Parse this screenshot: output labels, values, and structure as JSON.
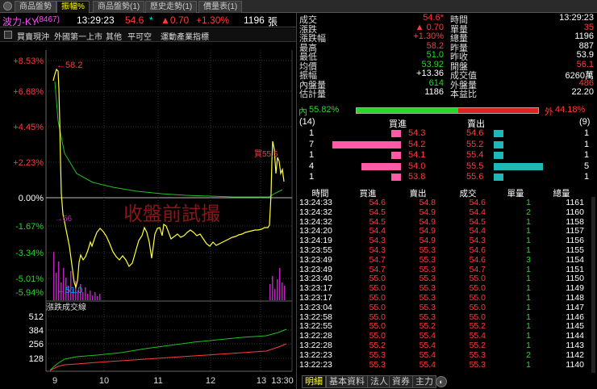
{
  "tabs": [
    "商品盤勢",
    "振幅%",
    "商品盤勢(1)",
    "歷史走勢(1)",
    "價量表(1)"
  ],
  "header": {
    "name": "波力-KY",
    "code": "(8467)",
    "time": "13:29:23",
    "price": "54.6",
    "star": "*",
    "change": "▲0.70",
    "change_pct": "+1.30%",
    "volume": "1196",
    "vol_unit": "張"
  },
  "menu": {
    "items": [
      "買賣現沖",
      "外國第一上市",
      "其他",
      "平可空",
      "運動產業指標"
    ]
  },
  "chart": {
    "y_labels": [
      "+8.53%",
      "+6.68%",
      "+4.45%",
      "+2.23%",
      "0.00%",
      "-1.67%",
      "-3.34%",
      "-5.01%",
      "-5.94%"
    ],
    "x_labels": [
      "9",
      "10",
      "11",
      "12",
      "13",
      "13:30"
    ],
    "high_label": "58.2",
    "low_label": "51.0",
    "mid_label": "56",
    "buy_mark": "買55.6",
    "watermark": "收盤前試撮",
    "vol_title": "漲跌成交線",
    "vol_ticks": [
      "512",
      "384",
      "256",
      "128"
    ],
    "colors": {
      "price": "#ffff3c",
      "avg": "#22c022",
      "vol": "#c020c0"
    }
  },
  "quote": {
    "left": [
      {
        "label": "成交",
        "value": "54.6*",
        "cls": "red"
      },
      {
        "label": "漲跌",
        "value": "▲ 0.70",
        "cls": "red"
      },
      {
        "label": "漲跌幅",
        "value": "+1.30%",
        "cls": "red"
      },
      {
        "label": "最高",
        "value": "58.2",
        "cls": "red"
      },
      {
        "label": "最低",
        "value": "51.0",
        "cls": "green"
      },
      {
        "label": "均價",
        "value": "53.92",
        "cls": "green"
      },
      {
        "label": "振幅",
        "value": "+13.36",
        "cls": "white"
      },
      {
        "label": "內盤量",
        "value": "614",
        "cls": "green"
      },
      {
        "label": "估計量",
        "value": "1186",
        "cls": "white"
      }
    ],
    "right": [
      {
        "label": "時間",
        "value": "13:29:23",
        "cls": "white"
      },
      {
        "label": "單量",
        "value": "35",
        "cls": "red"
      },
      {
        "label": "總量",
        "value": "1196",
        "cls": "white"
      },
      {
        "label": "昨量",
        "value": "887",
        "cls": "white"
      },
      {
        "label": "昨收",
        "value": "53.9",
        "cls": "white"
      },
      {
        "label": "開盤",
        "value": "56.1",
        "cls": "red"
      },
      {
        "label": "成交值",
        "value": "6260萬",
        "cls": "white"
      },
      {
        "label": "外盤量",
        "value": "486",
        "cls": "red"
      },
      {
        "label": "本益比",
        "value": "22.20",
        "cls": "white"
      }
    ]
  },
  "ratio": {
    "inner_label": "內",
    "inner_pct": "55.82%",
    "outer_label": "外",
    "outer_pct": "44.18%",
    "inner_fraction": 0.5582
  },
  "book": {
    "bid_count": "(14)",
    "ask_count": "(9)",
    "bid_header": "買進",
    "ask_header": "賣出",
    "rows": [
      {
        "bid_vol": "1",
        "bid": "54.3",
        "ask": "54.6",
        "ask_vol": "1",
        "bid_n": 1,
        "ask_n": 1
      },
      {
        "bid_vol": "7",
        "bid": "54.2",
        "ask": "55.2",
        "ask_vol": "1",
        "bid_n": 7,
        "ask_n": 1
      },
      {
        "bid_vol": "1",
        "bid": "54.1",
        "ask": "55.4",
        "ask_vol": "1",
        "bid_n": 1,
        "ask_n": 1
      },
      {
        "bid_vol": "4",
        "bid": "54.0",
        "ask": "55.5",
        "ask_vol": "5",
        "bid_n": 4,
        "ask_n": 5
      },
      {
        "bid_vol": "1",
        "bid": "53.8",
        "ask": "55.6",
        "ask_vol": "1",
        "bid_n": 1,
        "ask_n": 1
      }
    ]
  },
  "ticks": {
    "headers": [
      "時間",
      "買進",
      "賣出",
      "成交",
      "單量",
      "總量"
    ],
    "rows": [
      [
        "13:24:33",
        "54.6",
        "54.8",
        "54.6",
        "1",
        "1161"
      ],
      [
        "13:24:32",
        "54.5",
        "54.9",
        "54.4",
        "2",
        "1160"
      ],
      [
        "13:24:32",
        "54.5",
        "54.9",
        "54.5",
        "1",
        "1158"
      ],
      [
        "13:24:20",
        "54.4",
        "54.9",
        "54.4",
        "1",
        "1157"
      ],
      [
        "13:24:19",
        "54.3",
        "54.9",
        "54.3",
        "1",
        "1156"
      ],
      [
        "13:23:55",
        "54.3",
        "55.3",
        "54.6",
        "1",
        "1155"
      ],
      [
        "13:23:49",
        "54.7",
        "55.3",
        "54.6",
        "3",
        "1154"
      ],
      [
        "13:23:49",
        "54.7",
        "55.3",
        "54.7",
        "1",
        "1151"
      ],
      [
        "13:23:40",
        "55.0",
        "55.3",
        "55.0",
        "1",
        "1150"
      ],
      [
        "13:23:17",
        "55.0",
        "55.3",
        "55.0",
        "1",
        "1149"
      ],
      [
        "13:23:17",
        "55.0",
        "55.3",
        "55.0",
        "1",
        "1148"
      ],
      [
        "13:23:04",
        "55.0",
        "55.3",
        "55.0",
        "1",
        "1147"
      ],
      [
        "13:22:58",
        "55.0",
        "55.3",
        "55.0",
        "1",
        "1146"
      ],
      [
        "13:22:55",
        "55.0",
        "55.2",
        "55.2",
        "1",
        "1145"
      ],
      [
        "13:22:28",
        "55.0",
        "55.4",
        "55.4",
        "1",
        "1144"
      ],
      [
        "13:22:28",
        "55.2",
        "55.4",
        "55.2",
        "1",
        "1143"
      ],
      [
        "13:22:23",
        "55.3",
        "55.4",
        "55.3",
        "2",
        "1142"
      ],
      [
        "13:22:23",
        "55.3",
        "55.4",
        "55.3",
        "1",
        "1140"
      ]
    ]
  },
  "bottom_tabs": [
    "明細",
    "基本資料",
    "法人",
    "資券",
    "主力"
  ]
}
